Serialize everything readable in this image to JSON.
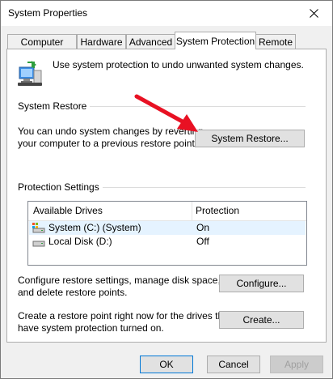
{
  "window": {
    "title": "System Properties"
  },
  "tabs": [
    {
      "label": "Computer Name",
      "active": false
    },
    {
      "label": "Hardware",
      "active": false
    },
    {
      "label": "Advanced",
      "active": false
    },
    {
      "label": "System Protection",
      "active": true
    },
    {
      "label": "Remote",
      "active": false
    }
  ],
  "intro_text": "Use system protection to undo unwanted system changes.",
  "system_restore": {
    "group_label": "System Restore",
    "description_line1": "You can undo system changes by reverting",
    "description_line2": "your computer to a previous restore point.",
    "button_label": "System Restore..."
  },
  "protection_settings": {
    "group_label": "Protection Settings",
    "columns": [
      "Available Drives",
      "Protection"
    ],
    "drives": [
      {
        "name": "System (C:) (System)",
        "protection": "On",
        "icon": "system-drive-icon"
      },
      {
        "name": "Local Disk (D:)",
        "protection": "Off",
        "icon": "local-drive-icon"
      }
    ],
    "configure_text_line1": "Configure restore settings, manage disk space,",
    "configure_text_line2": "and delete restore points.",
    "configure_button": "Configure...",
    "create_text_line1": "Create a restore point right now for the drives that",
    "create_text_line2": "have system protection turned on.",
    "create_button": "Create..."
  },
  "footer": {
    "ok": "OK",
    "cancel": "Cancel",
    "apply": "Apply"
  },
  "colors": {
    "accent_border": "#0078d7",
    "arrow": "#e81123",
    "selection": "#e5f3ff"
  }
}
